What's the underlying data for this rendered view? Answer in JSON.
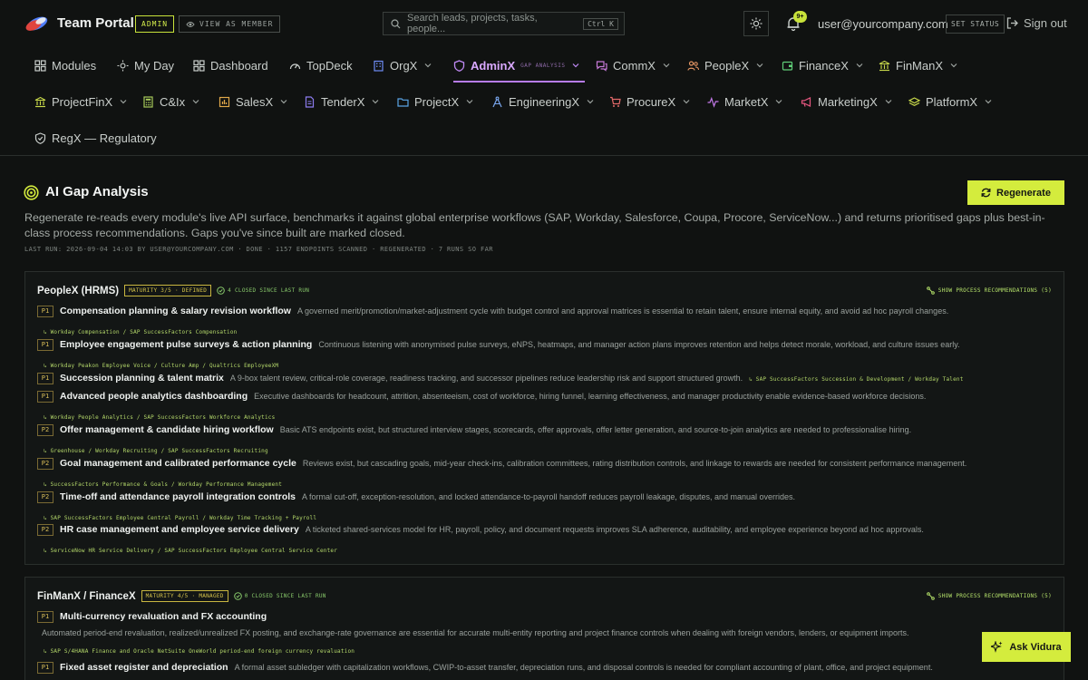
{
  "header": {
    "brand": "Team Portal",
    "role_badge": "ADMIN",
    "view_as_member": "VIEW AS MEMBER",
    "search_placeholder": "Search leads, projects, tasks, people...",
    "search_shortcut": "Ctrl K",
    "notification_count": "9+",
    "user_email": "user@yourcompany.com",
    "set_status": "SET STATUS",
    "sign_out": "Sign out",
    "accent_color": "#d4ec3d"
  },
  "nav": {
    "row1": [
      {
        "label": "Modules",
        "icon": "grid-icon",
        "chevron": false
      },
      {
        "label": "My Day",
        "icon": "sun-icon",
        "chevron": false
      },
      {
        "label": "Dashboard",
        "icon": "grid-icon",
        "chevron": false
      },
      {
        "label": "TopDeck",
        "icon": "gauge-icon",
        "chevron": false
      },
      {
        "label": "OrgX",
        "icon": "building-icon",
        "chevron": true
      },
      {
        "label": "AdminX",
        "sub": "GAP ANALYSIS",
        "icon": "shield-icon",
        "chevron": true,
        "active": true
      },
      {
        "label": "CommX",
        "icon": "chat-icon",
        "chevron": true
      },
      {
        "label": "PeopleX",
        "icon": "people-icon",
        "chevron": true
      },
      {
        "label": "FinanceX",
        "icon": "wallet-icon",
        "chevron": true
      },
      {
        "label": "FinManX",
        "icon": "bank-icon",
        "chevron": true
      }
    ],
    "row2": [
      {
        "label": "ProjectFinX",
        "icon": "bank-icon",
        "chevron": true
      },
      {
        "label": "C&Ix",
        "icon": "calculator-icon",
        "chevron": true
      },
      {
        "label": "SalesX",
        "icon": "chart-icon",
        "chevron": true
      },
      {
        "label": "TenderX",
        "icon": "document-icon",
        "chevron": true
      },
      {
        "label": "ProjectX",
        "icon": "folder-icon",
        "chevron": true
      },
      {
        "label": "EngineeringX",
        "icon": "compass-icon",
        "chevron": true
      },
      {
        "label": "ProcureX",
        "icon": "cart-icon",
        "chevron": true
      },
      {
        "label": "MarketX",
        "icon": "pulse-icon",
        "chevron": true
      },
      {
        "label": "MarketingX",
        "icon": "megaphone-icon",
        "chevron": true
      },
      {
        "label": "PlatformX",
        "icon": "layers-icon",
        "chevron": true
      }
    ],
    "row3": [
      {
        "label": "RegX — Regulatory",
        "icon": "shield-check-icon",
        "chevron": false
      }
    ]
  },
  "page": {
    "title": "AI Gap Analysis",
    "regenerate_label": "Regenerate",
    "description": "Regenerate re-reads every module's live API surface, benchmarks it against global enterprise workflows (SAP, Workday, Salesforce, Coupa, Procore, ServiceNow...) and returns prioritised gaps plus best-in-class process recommendations. Gaps you've since built are marked closed.",
    "run_meta": "LAST RUN: 2026-09-04 14:03 BY USER@YOURCOMPANY.COM · DONE · 1157 ENDPOINTS SCANNED · REGENERATED · 7 RUNS SO FAR"
  },
  "cards": [
    {
      "title": "PeopleX (HRMS)",
      "maturity": "MATURITY 3/5 · DEFINED",
      "closed": "4 CLOSED SINCE LAST RUN",
      "show_recs": "SHOW PROCESS RECOMMENDATIONS (5)",
      "gaps": [
        {
          "priority": "P1",
          "title": "Compensation planning & salary revision workflow",
          "desc": "A governed merit/promotion/market-adjustment cycle with budget control and approval matrices is essential to retain talent, ensure internal equity, and avoid ad hoc payroll changes.",
          "ref": "↳ Workday Compensation / SAP SuccessFactors Compensation",
          "ref_inline": false
        },
        {
          "priority": "P1",
          "title": "Employee engagement pulse surveys & action planning",
          "desc": "Continuous listening with anonymised pulse surveys, eNPS, heatmaps, and manager action plans improves retention and helps detect morale, workload, and culture issues early.",
          "ref": "↳ Workday Peakon Employee Voice / Culture Amp / Qualtrics EmployeeXM",
          "ref_inline": false
        },
        {
          "priority": "P1",
          "title": "Succession planning & talent matrix",
          "desc": "A 9-box talent review, critical-role coverage, readiness tracking, and successor pipelines reduce leadership risk and support structured growth.",
          "ref": "↳ SAP SuccessFactors Succession & Development / Workday Talent",
          "ref_inline": true
        },
        {
          "priority": "P1",
          "title": "Advanced people analytics dashboarding",
          "desc": "Executive dashboards for headcount, attrition, absenteeism, cost of workforce, hiring funnel, learning effectiveness, and manager productivity enable evidence-based workforce decisions.",
          "ref": "↳ Workday People Analytics / SAP SuccessFactors Workforce Analytics",
          "ref_inline": false
        },
        {
          "priority": "P2",
          "title": "Offer management & candidate hiring workflow",
          "desc": "Basic ATS endpoints exist, but structured interview stages, scorecards, offer approvals, offer letter generation, and source-to-join analytics are needed to professionalise hiring.",
          "ref": "↳ Greenhouse / Workday Recruiting / SAP SuccessFactors Recruiting",
          "ref_inline": false
        },
        {
          "priority": "P2",
          "title": "Goal management and calibrated performance cycle",
          "desc": "Reviews exist, but cascading goals, mid-year check-ins, calibration committees, rating distribution controls, and linkage to rewards are needed for consistent performance management.",
          "ref": "↳ SuccessFactors Performance & Goals / Workday Performance Management",
          "ref_inline": false
        },
        {
          "priority": "P2",
          "title": "Time-off and attendance payroll integration controls",
          "desc": "A formal cut-off, exception-resolution, and locked attendance-to-payroll handoff reduces payroll leakage, disputes, and manual overrides.",
          "ref": "↳ SAP SuccessFactors Employee Central Payroll / Workday Time Tracking + Payroll",
          "ref_inline": false
        },
        {
          "priority": "P2",
          "title": "HR case management and employee service delivery",
          "desc": "A ticketed shared-services model for HR, payroll, policy, and document requests improves SLA adherence, auditability, and employee experience beyond ad hoc approvals.",
          "ref": "↳ ServiceNow HR Service Delivery / SAP SuccessFactors Employee Central Service Center",
          "ref_inline": false
        }
      ]
    },
    {
      "title": "FinManX / FinanceX",
      "maturity": "MATURITY 4/5 · MANAGED",
      "closed": "0 CLOSED SINCE LAST RUN",
      "show_recs": "SHOW PROCESS RECOMMENDATIONS (5)",
      "gaps": [
        {
          "priority": "P1",
          "title": "Multi-currency revaluation and FX accounting",
          "desc": "Automated period-end revaluation, realized/unrealized FX posting, and exchange-rate governance are essential for accurate multi-entity reporting and project finance controls when dealing with foreign vendors, lenders, or equipment imports.",
          "ref": "↳ SAP S/4HANA Finance and Oracle NetSuite OneWorld period-end foreign currency revaluation",
          "ref_inline": false,
          "desc_below": true
        },
        {
          "priority": "P1",
          "title": "Fixed asset register and depreciation",
          "desc": "A formal asset subledger with capitalization workflows, CWIP-to-asset transfer, depreciation runs, and disposal controls is needed for compliant accounting of plant, office, and project equipment.",
          "ref": "",
          "ref_inline": false
        }
      ]
    }
  ],
  "assistant": {
    "label": "Ask Vidura"
  }
}
